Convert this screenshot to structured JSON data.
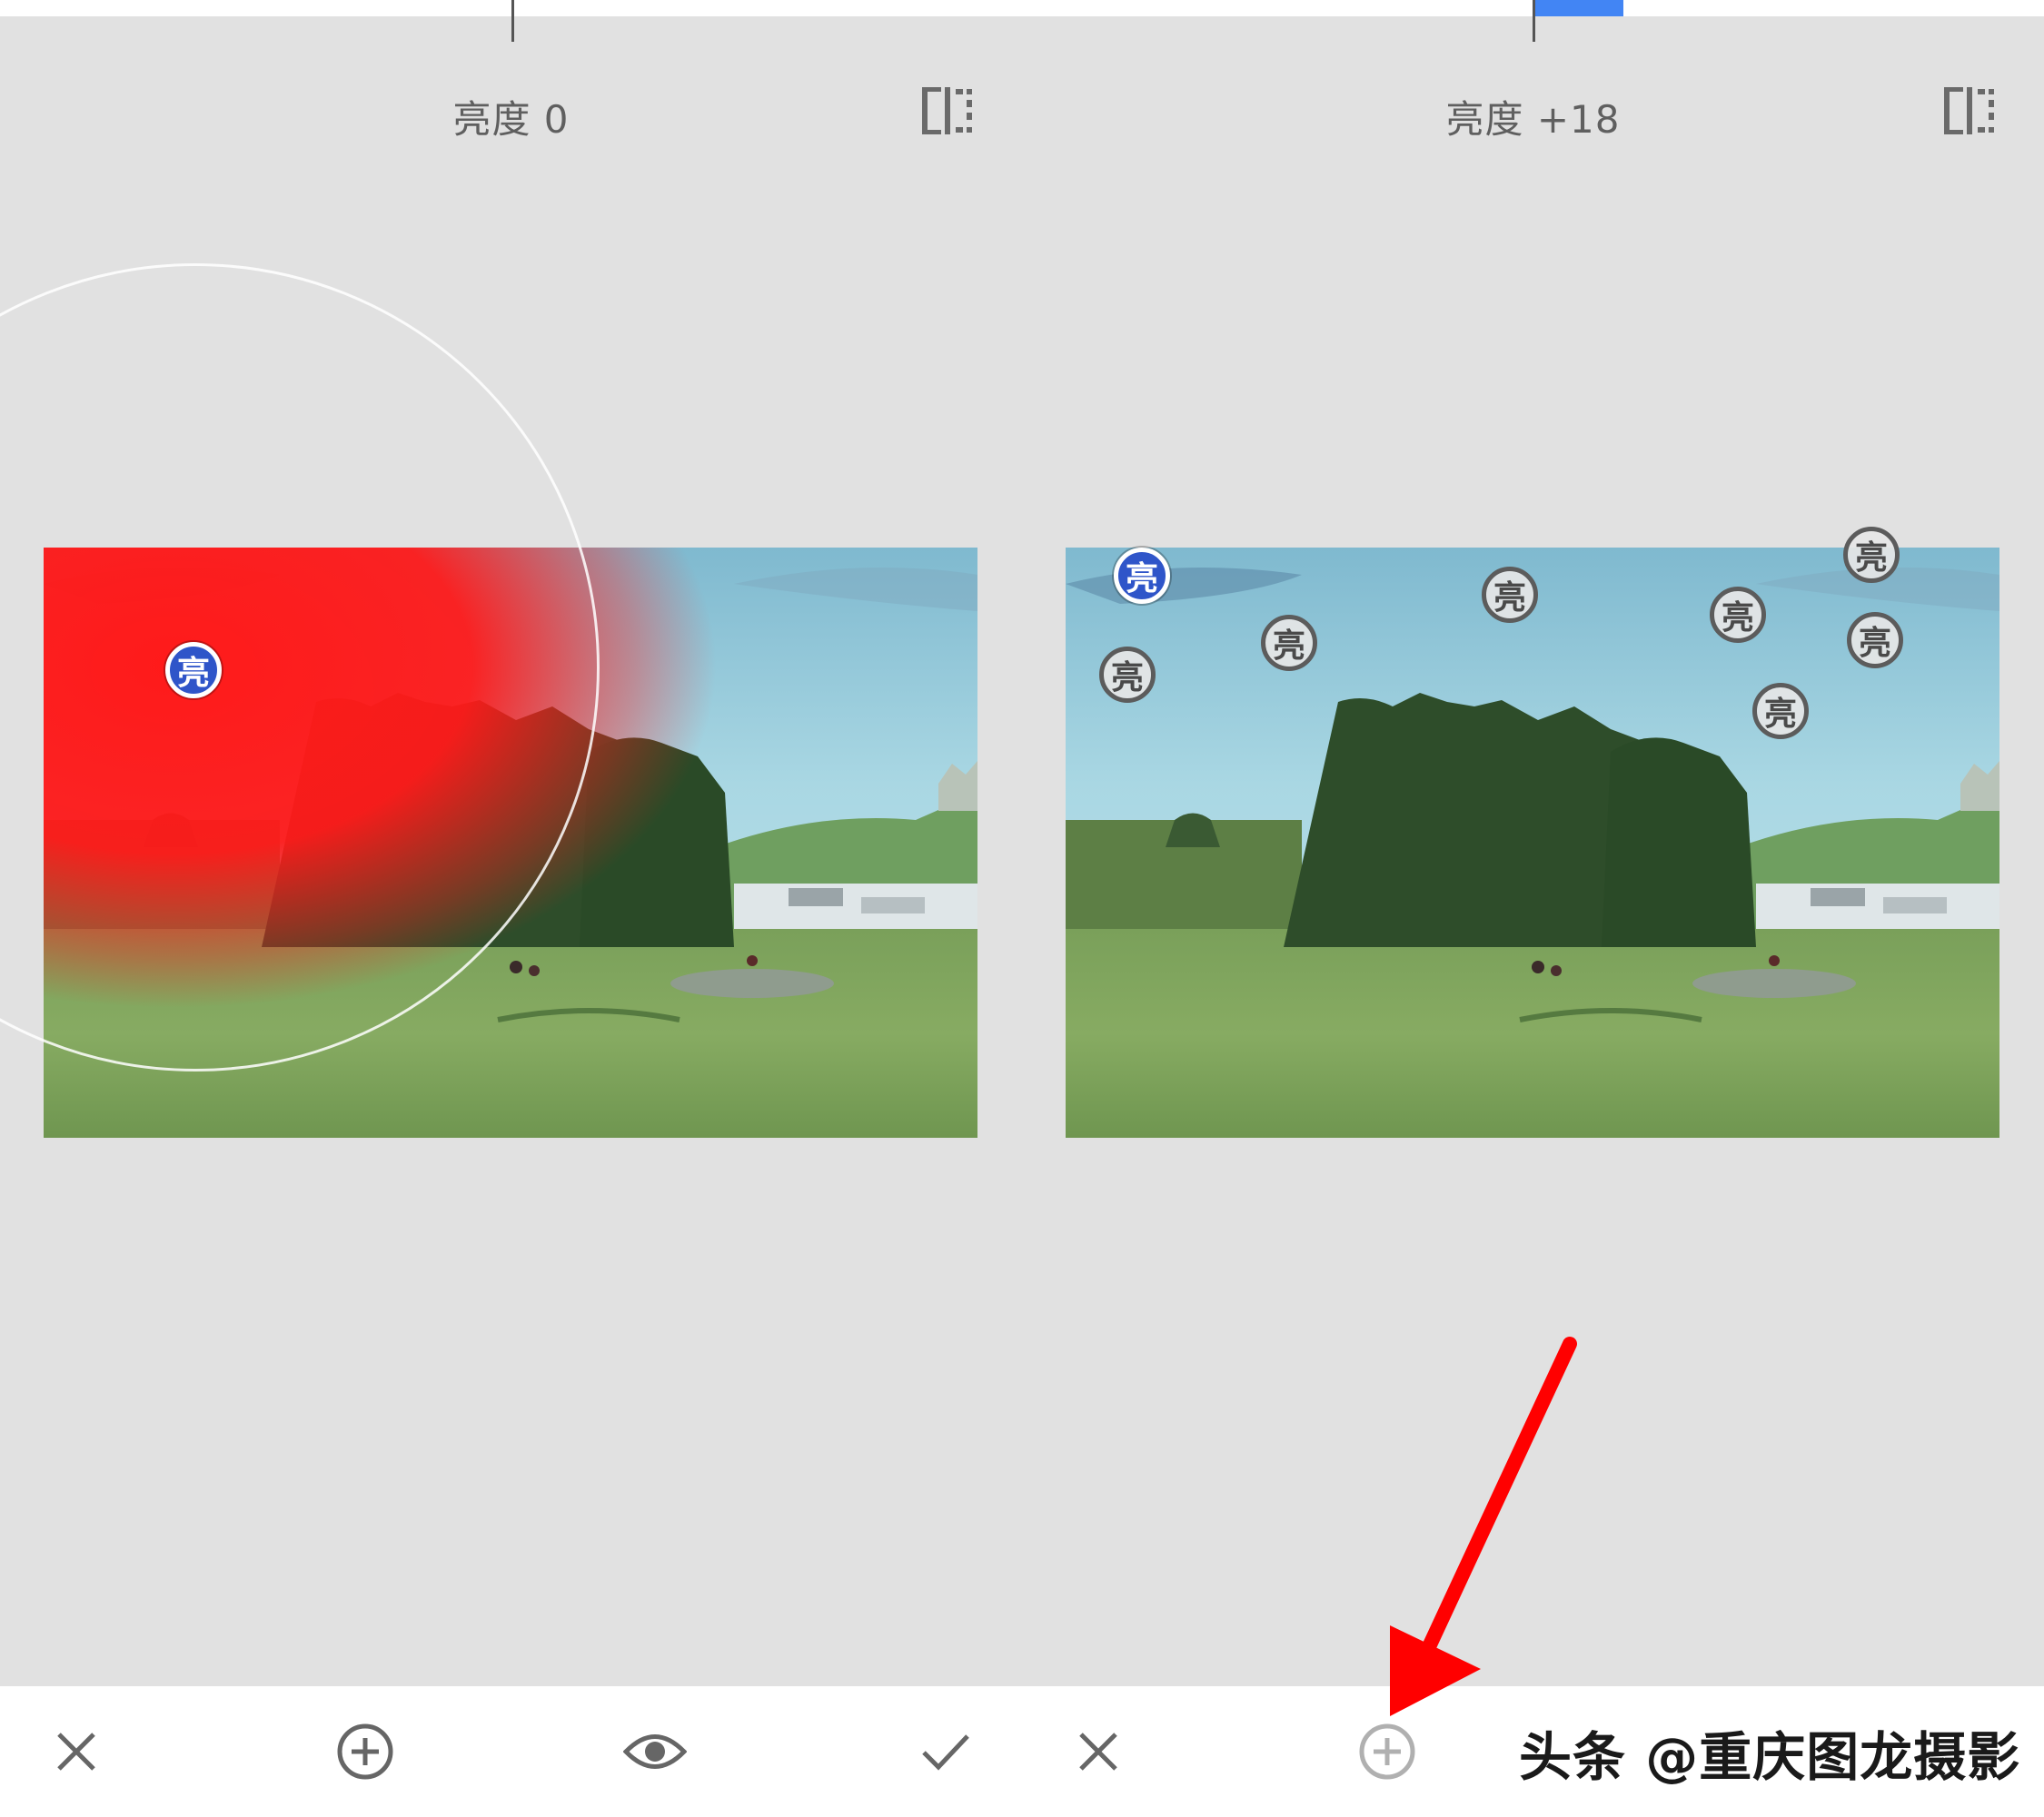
{
  "left_panel": {
    "parameter_label": "亮度 0",
    "pin_label": "亮",
    "toolbar": {
      "cancel_icon": "close-icon",
      "add_icon": "add-circle-icon",
      "preview_icon": "eye-icon",
      "confirm_icon": "check-icon"
    }
  },
  "right_panel": {
    "parameter_label": "亮度 +18",
    "pin_label": "亮",
    "toolbar": {
      "cancel_icon": "close-icon",
      "add_icon": "add-circle-icon"
    }
  },
  "overlay": {
    "watermark": "头条 @重庆图龙摄影",
    "arrow_color": "#ff0000"
  },
  "colors": {
    "background": "#e1e1e1",
    "accent": "#4285f4",
    "active_pin": "#2f55c9",
    "mask_red": "#ff1a1a"
  }
}
